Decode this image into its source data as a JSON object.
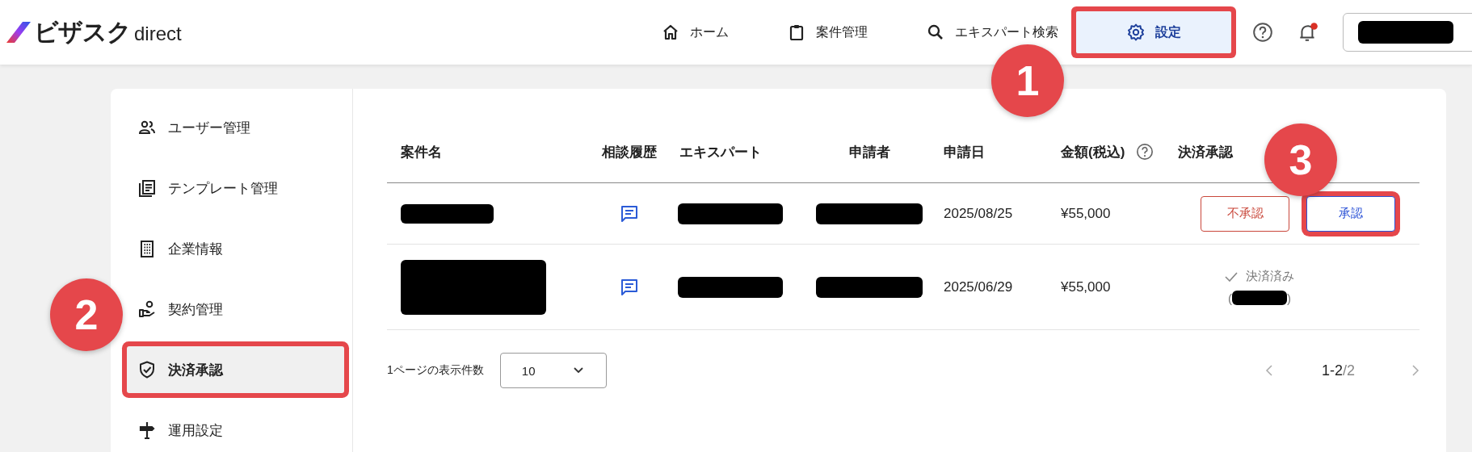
{
  "header": {
    "logo_text": "ビザスク",
    "logo_suffix": "direct",
    "nav": [
      {
        "label": "ホーム",
        "selected": false,
        "highlighted": false
      },
      {
        "label": "案件管理",
        "selected": false,
        "highlighted": false
      },
      {
        "label": "エキスパート検索",
        "selected": false,
        "highlighted": false
      },
      {
        "label": "設定",
        "selected": true,
        "highlighted": true
      }
    ],
    "notifications_unread": true
  },
  "sidebar": {
    "items": [
      {
        "label": "ユーザー管理",
        "selected": false,
        "highlighted": false
      },
      {
        "label": "テンプレート管理",
        "selected": false,
        "highlighted": false
      },
      {
        "label": "企業情報",
        "selected": false,
        "highlighted": false
      },
      {
        "label": "契約管理",
        "selected": false,
        "highlighted": false
      },
      {
        "label": "決済承認",
        "selected": true,
        "highlighted": true
      },
      {
        "label": "運用設定",
        "selected": false,
        "highlighted": false
      }
    ]
  },
  "table": {
    "columns": [
      "案件名",
      "相談履歴",
      "エキスパート",
      "申請者",
      "申請日",
      "金額(税込)",
      "決済承認"
    ],
    "rows": [
      {
        "date": "2025/08/25",
        "amount": "¥55,000",
        "kind": "pending",
        "reject_label": "不承認",
        "approve_label": "承認",
        "approve_highlighted": true
      },
      {
        "date": "2025/06/29",
        "amount": "¥55,000",
        "kind": "settled",
        "settled_label": "決済済み",
        "settled_by_open": "(",
        "settled_by_close": ")"
      }
    ]
  },
  "pagination": {
    "per_page_label": "1ページの表示件数",
    "per_page": "10",
    "range": "1-2",
    "separator": "/",
    "total": "2"
  },
  "annotations": [
    {
      "number": "1"
    },
    {
      "number": "2"
    },
    {
      "number": "3"
    }
  ]
}
